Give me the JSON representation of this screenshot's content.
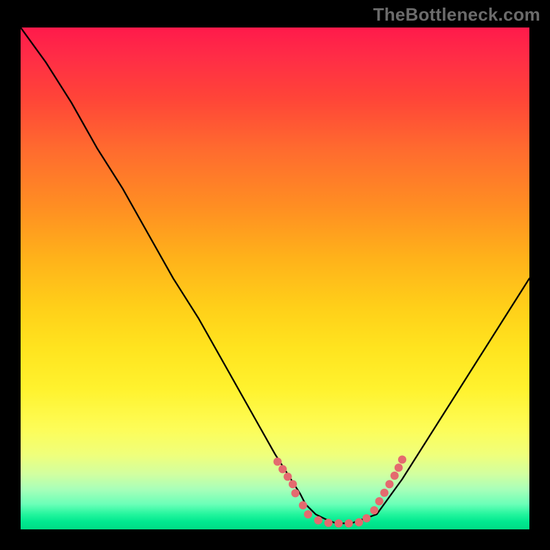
{
  "watermark": "TheBottleneck.com",
  "chart_data": {
    "type": "line",
    "title": "",
    "xlabel": "",
    "ylabel": "",
    "xlim": [
      0,
      100
    ],
    "ylim": [
      0,
      100
    ],
    "grid": false,
    "series": [
      {
        "name": "curve",
        "x": [
          0,
          5,
          10,
          15,
          20,
          25,
          30,
          35,
          40,
          45,
          50,
          55,
          56,
          58,
          60,
          62,
          65,
          70,
          75,
          80,
          85,
          90,
          95,
          100
        ],
        "y": [
          100,
          93,
          85,
          76,
          68,
          59,
          50,
          42,
          33,
          24,
          15,
          7,
          5,
          3,
          2,
          1.2,
          1.2,
          3,
          10,
          18,
          26,
          34,
          42,
          50
        ]
      }
    ],
    "markers": [
      {
        "x": 50.5,
        "y": 13.5
      },
      {
        "x": 51.5,
        "y": 12.0
      },
      {
        "x": 52.5,
        "y": 10.5
      },
      {
        "x": 53.5,
        "y": 9.0
      },
      {
        "x": 54.0,
        "y": 7.2
      },
      {
        "x": 55.5,
        "y": 4.8
      },
      {
        "x": 56.5,
        "y": 3.0
      },
      {
        "x": 58.5,
        "y": 1.8
      },
      {
        "x": 60.5,
        "y": 1.3
      },
      {
        "x": 62.5,
        "y": 1.2
      },
      {
        "x": 64.5,
        "y": 1.2
      },
      {
        "x": 66.5,
        "y": 1.4
      },
      {
        "x": 68.0,
        "y": 2.2
      },
      {
        "x": 69.5,
        "y": 3.8
      },
      {
        "x": 70.5,
        "y": 5.6
      },
      {
        "x": 71.5,
        "y": 7.3
      },
      {
        "x": 72.5,
        "y": 9.0
      },
      {
        "x": 73.5,
        "y": 10.7
      },
      {
        "x": 74.3,
        "y": 12.3
      },
      {
        "x": 75.0,
        "y": 13.9
      }
    ],
    "marker_color": "#e46a6f",
    "background_gradient": [
      "#ff1a4b",
      "#00db85"
    ]
  }
}
